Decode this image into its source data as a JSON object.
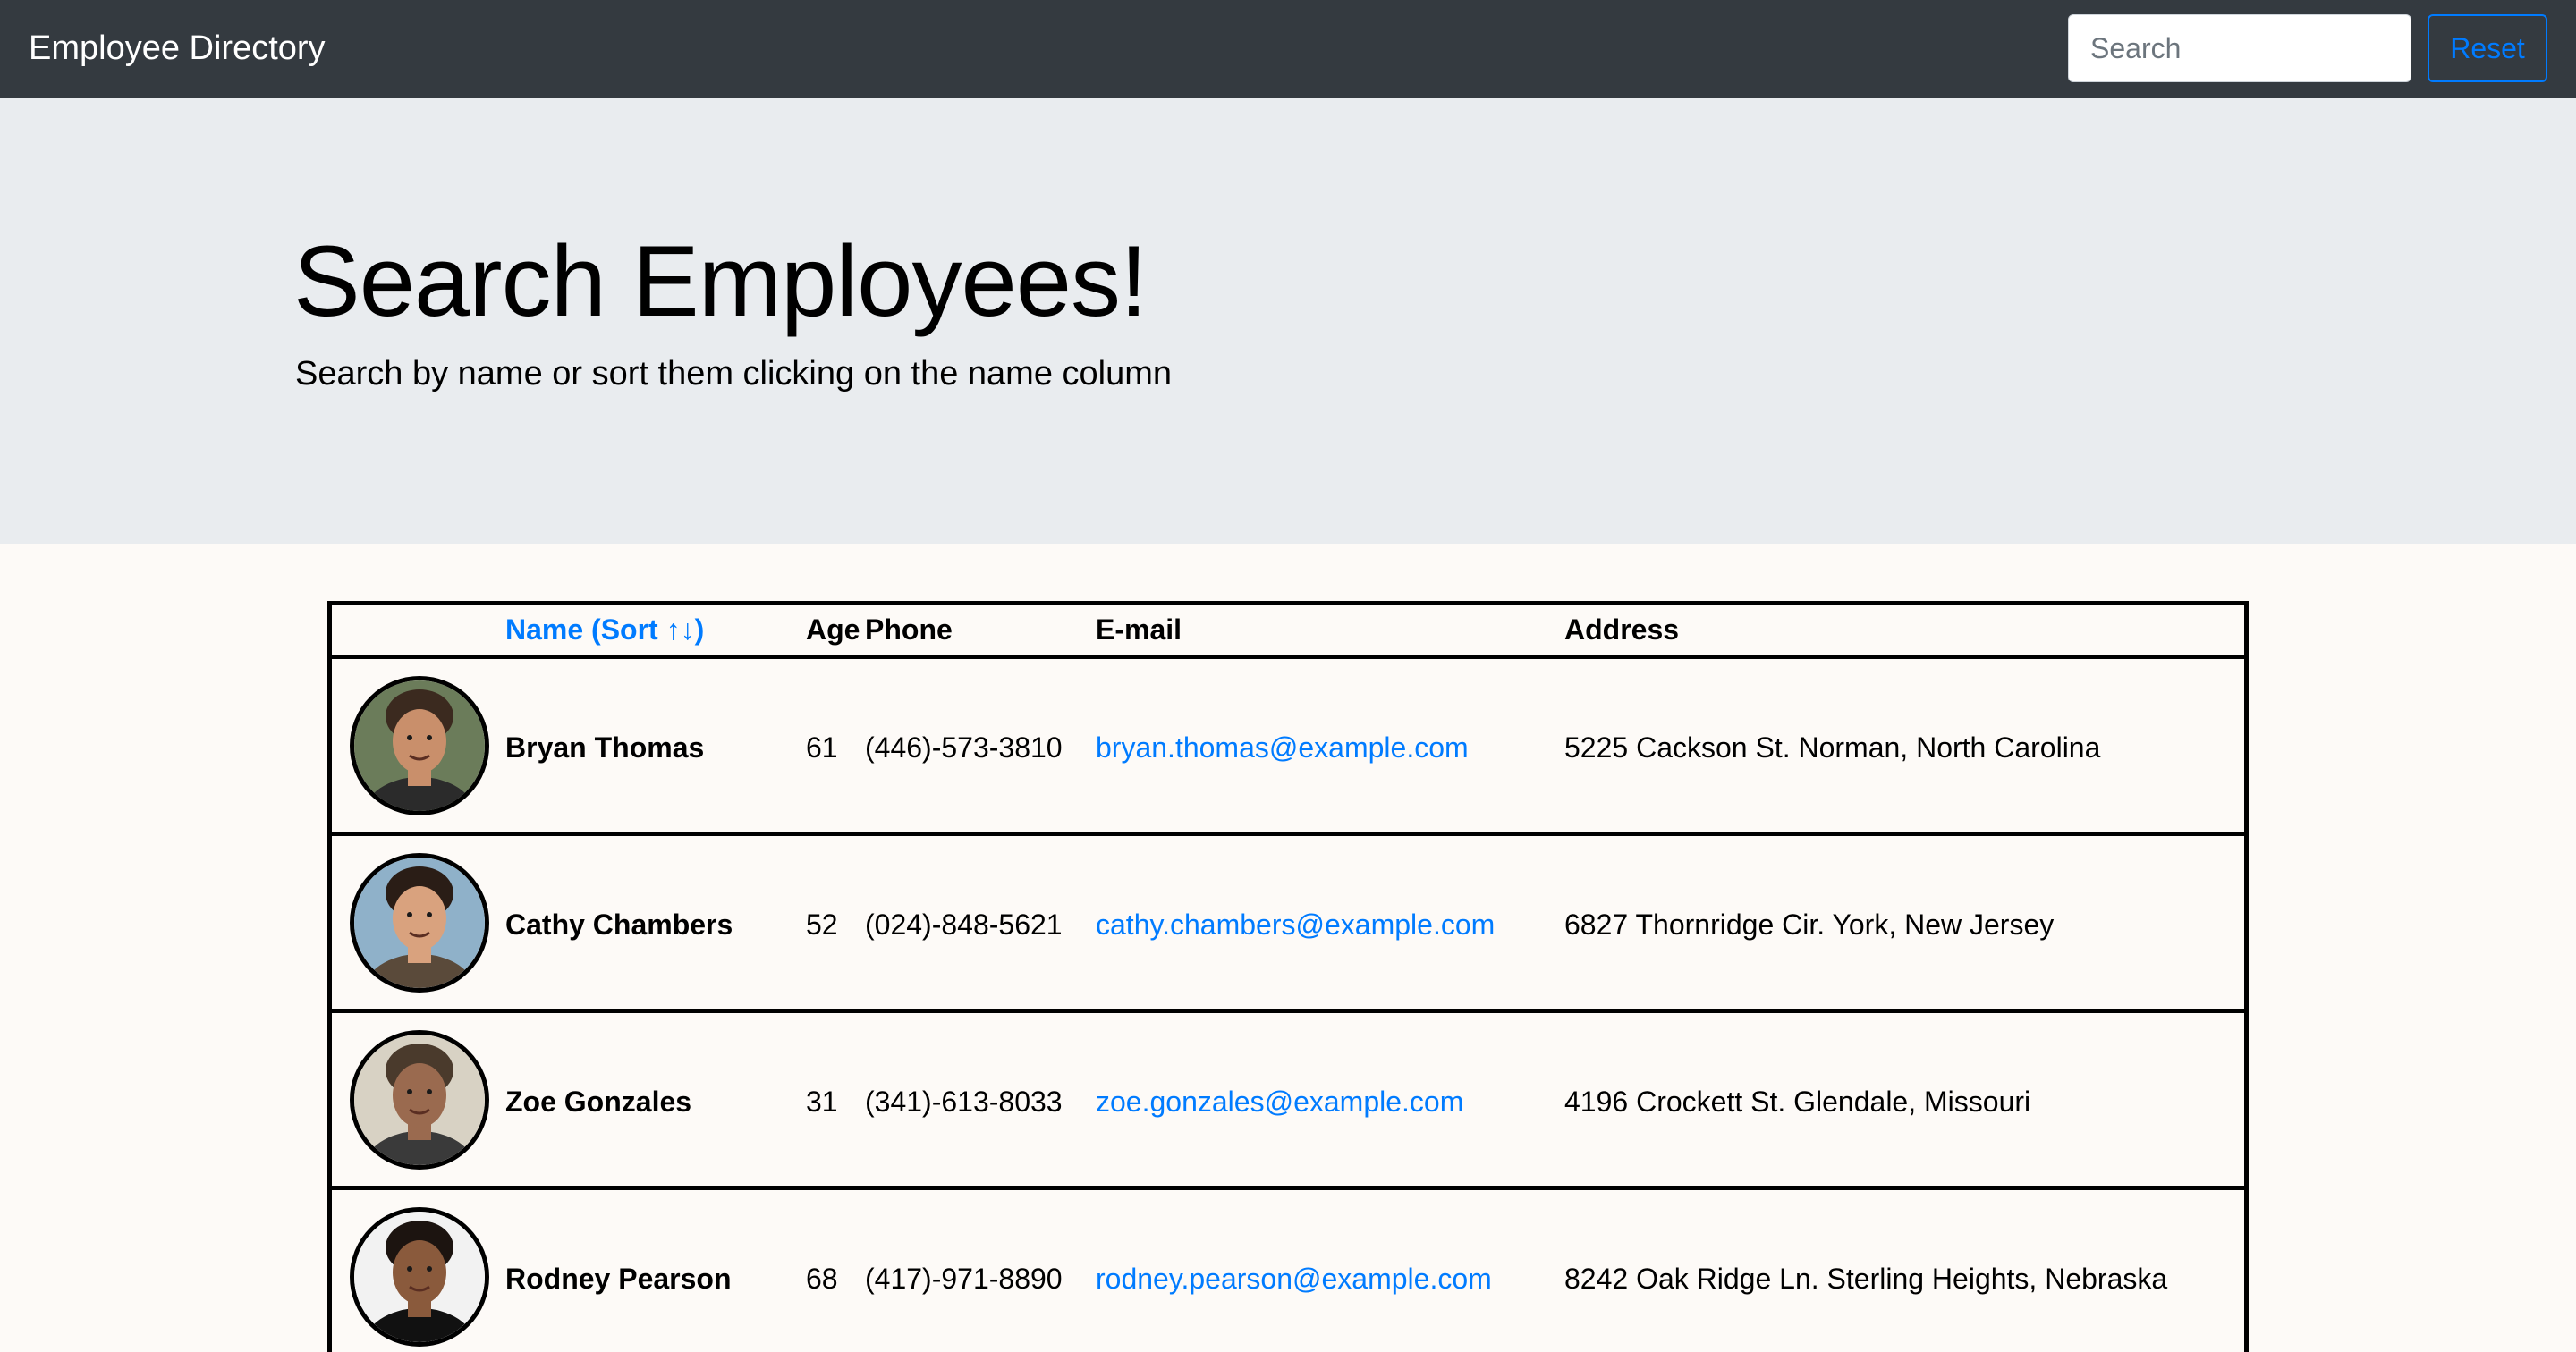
{
  "navbar": {
    "brand": "Employee Directory",
    "search_placeholder": "Search",
    "reset_label": "Reset"
  },
  "jumbotron": {
    "title": "Search Employees!",
    "subtitle": "Search by name or sort them clicking on the name column"
  },
  "table": {
    "headers": {
      "name": "Name (Sort ↑↓)",
      "age": "Age",
      "phone": "Phone",
      "email": "E-mail",
      "address": "Address"
    },
    "rows": [
      {
        "name": "Bryan Thomas",
        "age": "61",
        "phone": "(446)-573-3810",
        "email": "bryan.thomas@example.com",
        "address": "5225 Cackson St. Norman, North Carolina",
        "avatar": {
          "skin": "#c98f6b",
          "hair": "#3b2a1f",
          "bg": "#6b7c5a",
          "shirt": "#2b2b2b"
        }
      },
      {
        "name": "Cathy Chambers",
        "age": "52",
        "phone": "(024)-848-5621",
        "email": "cathy.chambers@example.com",
        "address": "6827 Thornridge Cir. York, New Jersey",
        "avatar": {
          "skin": "#d9a27e",
          "hair": "#2a1d16",
          "bg": "#8fb1c9",
          "shirt": "#5a4a3a"
        }
      },
      {
        "name": "Zoe Gonzales",
        "age": "31",
        "phone": "(341)-613-8033",
        "email": "zoe.gonzales@example.com",
        "address": "4196 Crockett St. Glendale, Missouri",
        "avatar": {
          "skin": "#9a6a4f",
          "hair": "#4a3a2c",
          "bg": "#d8d2c4",
          "shirt": "#3a3a3a"
        }
      },
      {
        "name": "Rodney Pearson",
        "age": "68",
        "phone": "(417)-971-8890",
        "email": "rodney.pearson@example.com",
        "address": "8242 Oak Ridge Ln. Sterling Heights, Nebraska",
        "avatar": {
          "skin": "#8a5a3c",
          "hair": "#1c1410",
          "bg": "#f2f2f2",
          "shirt": "#111111"
        }
      }
    ]
  }
}
